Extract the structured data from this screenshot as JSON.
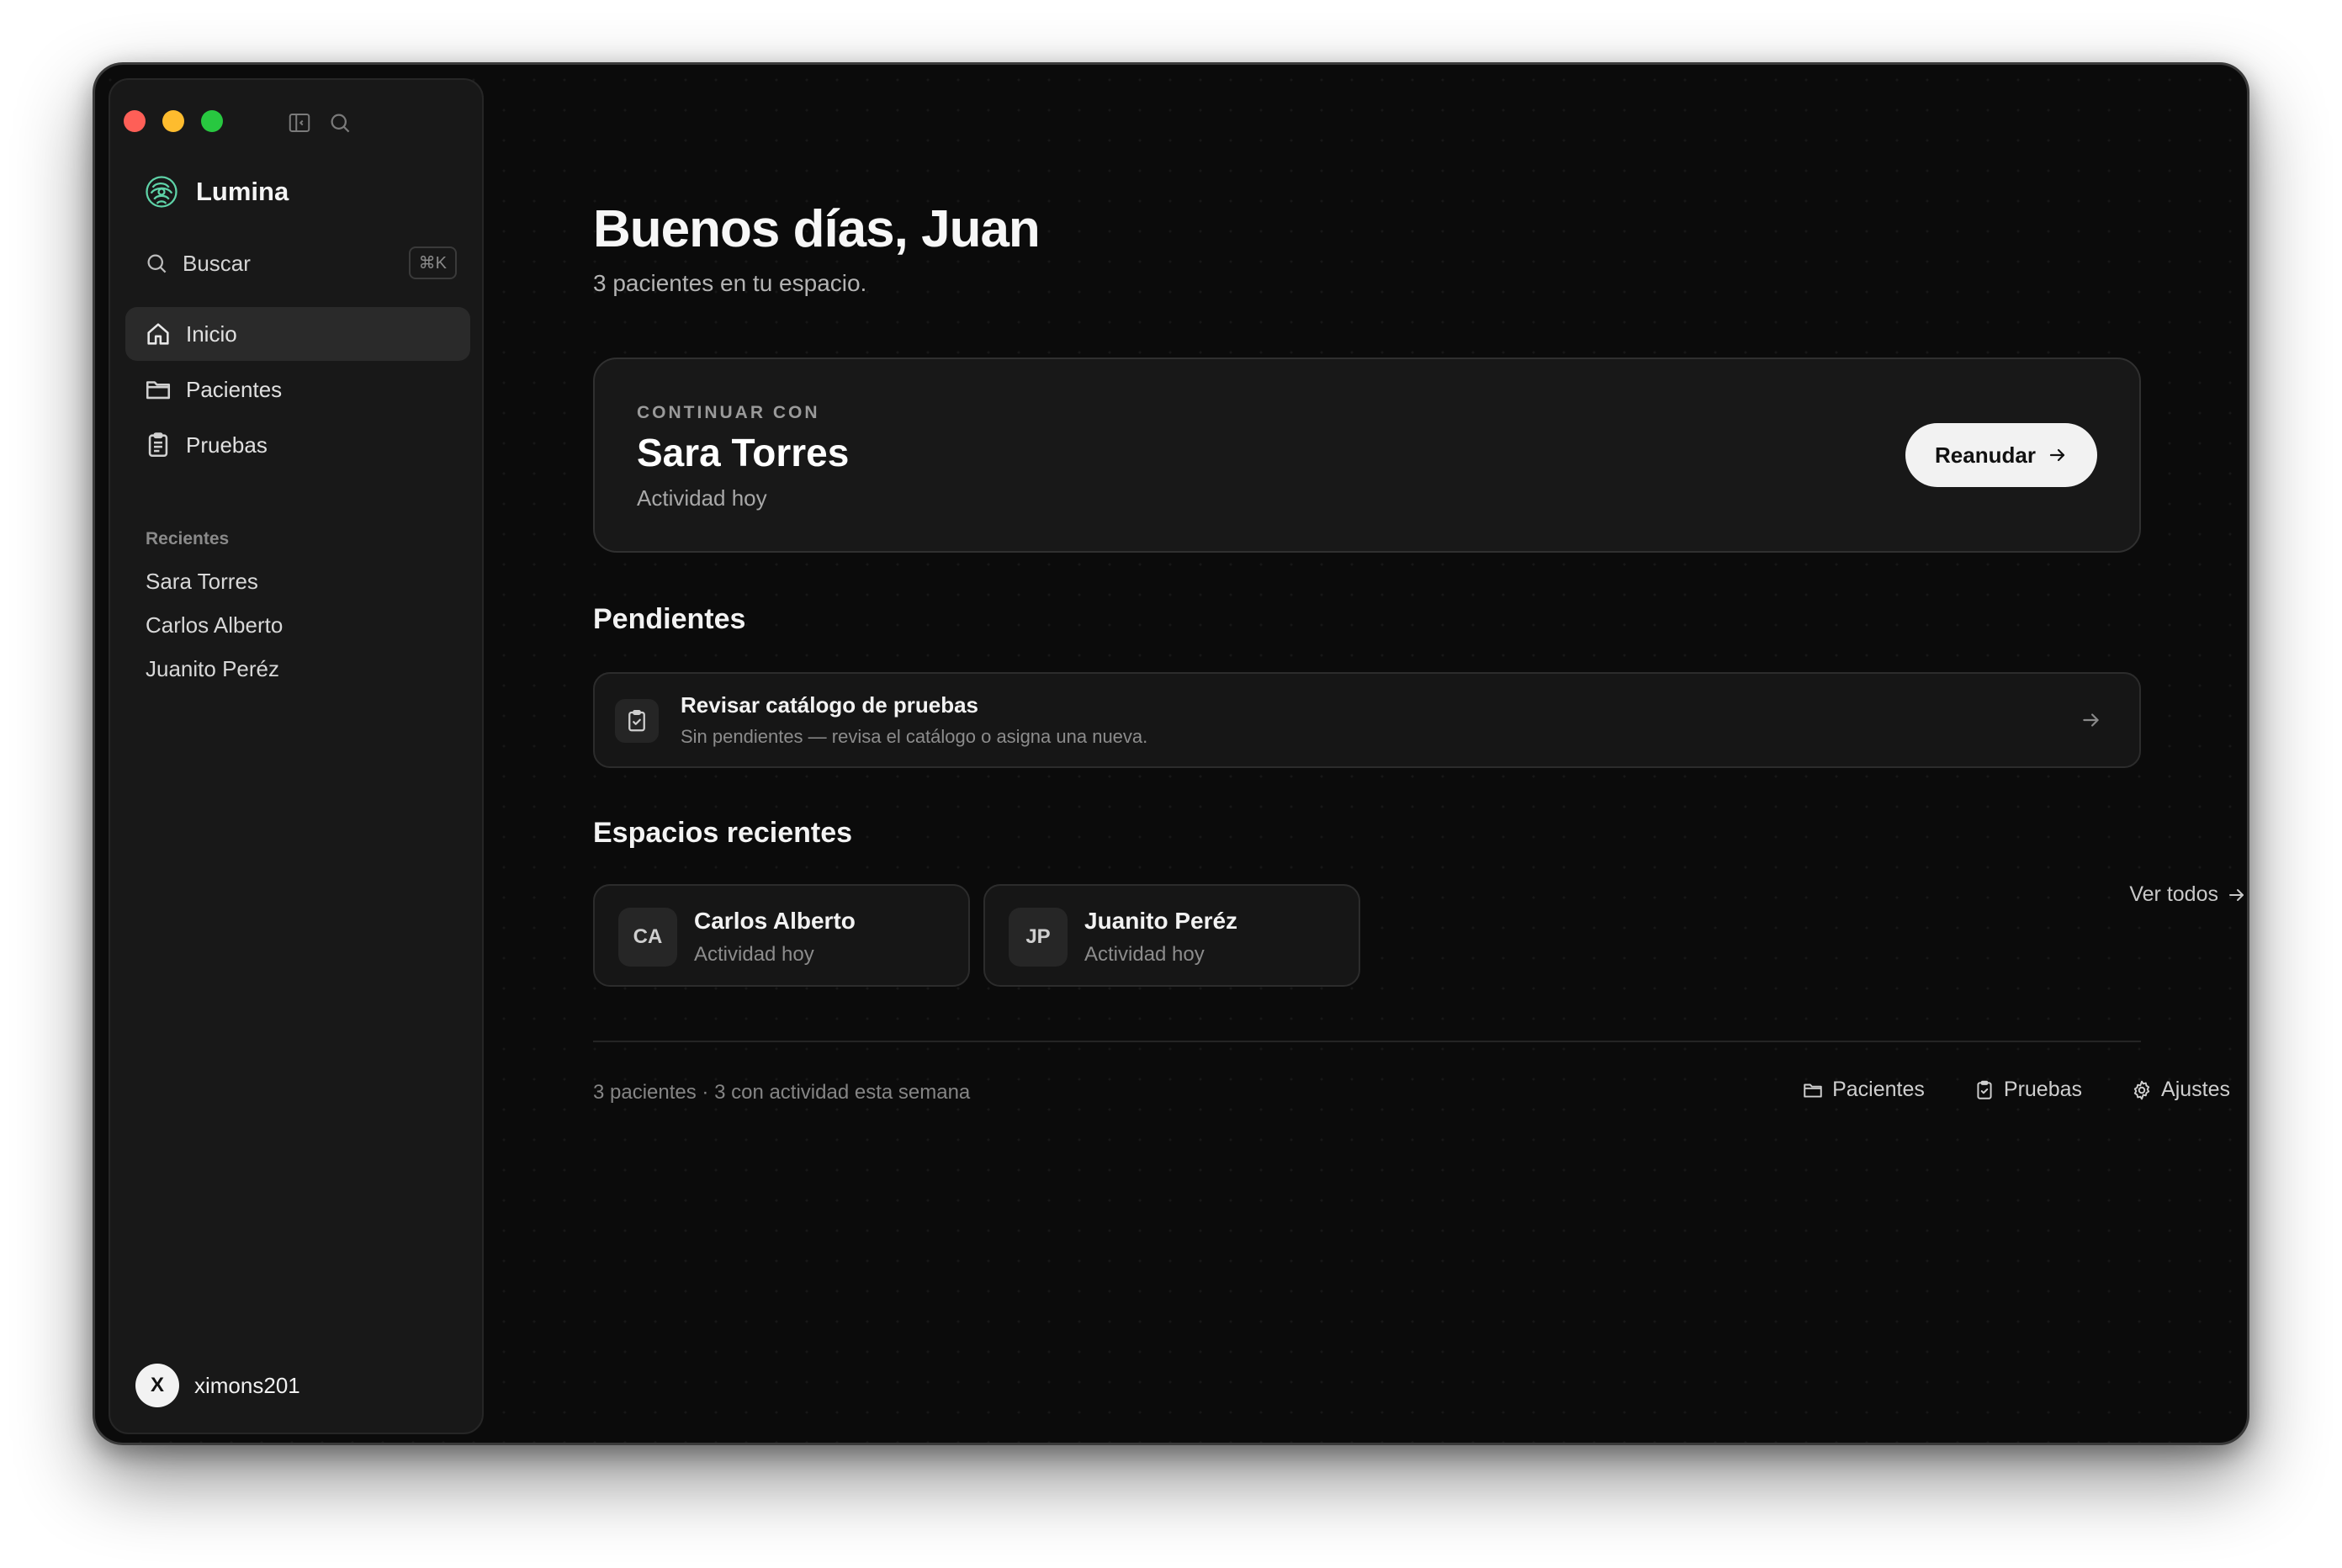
{
  "window": {
    "sidebar": {
      "brand": "Lumina",
      "search": {
        "label": "Buscar",
        "shortcut": "⌘K"
      },
      "nav": [
        {
          "label": "Inicio",
          "icon": "home-icon",
          "active": true
        },
        {
          "label": "Pacientes",
          "icon": "folder-icon",
          "active": false
        },
        {
          "label": "Pruebas",
          "icon": "clipboard-icon",
          "active": false
        }
      ],
      "recent_title": "Recientes",
      "recent": [
        "Sara Torres",
        "Carlos Alberto",
        "Juanito Peréz"
      ],
      "user": {
        "initial": "X",
        "name": "ximons201"
      }
    },
    "main": {
      "greeting": "Buenos días, Juan",
      "subtitle": "3 pacientes en tu espacio.",
      "continue_card": {
        "kicker": "CONTINUAR CON",
        "name": "Sara Torres",
        "activity": "Actividad hoy",
        "button": "Reanudar"
      },
      "pending": {
        "title": "Pendientes",
        "item": {
          "title": "Revisar catálogo de pruebas",
          "subtitle": "Sin pendientes — revisa el catálogo o asigna una nueva."
        }
      },
      "spaces": {
        "title": "Espacios recientes",
        "see_all": "Ver todos",
        "items": [
          {
            "initials": "CA",
            "name": "Carlos Alberto",
            "activity": "Actividad hoy"
          },
          {
            "initials": "JP",
            "name": "Juanito Peréz",
            "activity": "Actividad hoy"
          }
        ]
      },
      "footer": {
        "stats": "3 pacientes · 3 con actividad esta semana",
        "links": [
          {
            "label": "Pacientes",
            "icon": "folder-icon"
          },
          {
            "label": "Pruebas",
            "icon": "clipboard-icon"
          },
          {
            "label": "Ajustes",
            "icon": "gear-icon"
          }
        ]
      }
    }
  },
  "colors": {
    "background": "#0b0b0b",
    "sidebar": "#181818",
    "accent_logo": "#5fd3a8"
  }
}
